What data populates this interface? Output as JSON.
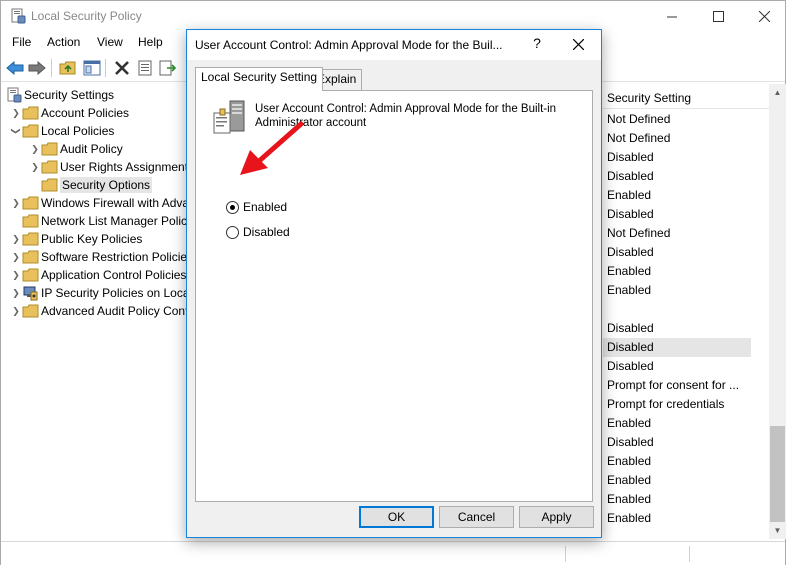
{
  "app": {
    "title": "Local Security Policy"
  },
  "menu": [
    "File",
    "Action",
    "View",
    "Help"
  ],
  "tree": [
    {
      "label": "Security Settings",
      "level": 0,
      "chevron": "none",
      "icon": "security-settings-icon"
    },
    {
      "label": "Account Policies",
      "level": 1,
      "chevron": "right",
      "icon": "folder-icon"
    },
    {
      "label": "Local Policies",
      "level": 1,
      "chevron": "down",
      "icon": "folder-icon"
    },
    {
      "label": "Audit Policy",
      "level": 2,
      "chevron": "right",
      "icon": "folder-icon"
    },
    {
      "label": "User Rights Assignment",
      "level": 2,
      "chevron": "right",
      "icon": "folder-icon"
    },
    {
      "label": "Security Options",
      "level": 2,
      "chevron": "none",
      "icon": "folder-icon",
      "selected": true
    },
    {
      "label": "Windows Firewall with Advanced Security",
      "level": 1,
      "chevron": "right",
      "icon": "folder-icon"
    },
    {
      "label": "Network List Manager Policies",
      "level": 1,
      "chevron": "none",
      "icon": "folder-icon"
    },
    {
      "label": "Public Key Policies",
      "level": 1,
      "chevron": "right",
      "icon": "folder-icon"
    },
    {
      "label": "Software Restriction Policies",
      "level": 1,
      "chevron": "right",
      "icon": "folder-icon"
    },
    {
      "label": "Application Control Policies",
      "level": 1,
      "chevron": "right",
      "icon": "folder-icon"
    },
    {
      "label": "IP Security Policies on Local Computer",
      "level": 1,
      "chevron": "right",
      "icon": "ip-security-icon"
    },
    {
      "label": "Advanced Audit Policy Configuration",
      "level": 1,
      "chevron": "right",
      "icon": "folder-icon"
    }
  ],
  "list": {
    "header": "Security Setting",
    "rows": [
      "Not Defined",
      "Not Defined",
      "Disabled",
      "Disabled",
      "Enabled",
      "Disabled",
      "Not Defined",
      "Disabled",
      "Enabled",
      "Enabled",
      "",
      "Disabled",
      "Disabled",
      "Disabled",
      "Prompt for consent for ...",
      "Prompt for credentials",
      "Enabled",
      "Disabled",
      "Enabled",
      "Enabled",
      "Enabled",
      "Enabled"
    ],
    "highlighted_index": 12
  },
  "dialog": {
    "title": "User Account Control: Admin Approval Mode for the Buil...",
    "help": "?",
    "tabs": [
      "Local Security Setting",
      "Explain"
    ],
    "policy_name": "User Account Control: Admin Approval Mode for the Built-in Administrator account",
    "options": [
      {
        "label": "Enabled",
        "checked": true
      },
      {
        "label": "Disabled",
        "checked": false
      }
    ],
    "buttons": {
      "ok": "OK",
      "cancel": "Cancel",
      "apply": "Apply"
    }
  },
  "colors": {
    "accent": "#0078d7",
    "dialog_border": "#1883d7",
    "annotation_arrow": "#e8141c",
    "folder": "#e8c15c"
  }
}
